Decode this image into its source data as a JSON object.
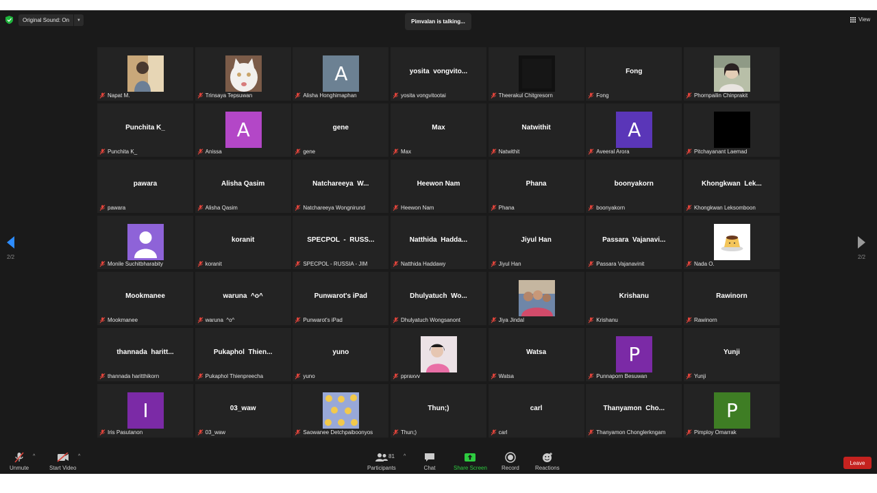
{
  "topbar": {
    "original_sound": "Original Sound: On",
    "talking": "Pimvalan is talking...",
    "view": "View"
  },
  "pager": {
    "left_page": "2/2",
    "right_page": "2/2"
  },
  "tiles": [
    {
      "name": "Napat M.",
      "type": "photo",
      "photo": "photo-person-1",
      "bg": "#c9a87a"
    },
    {
      "name": "Trinsaya Tepsuwan",
      "type": "photo",
      "photo": "photo-cat",
      "bg": "#8a6f5a"
    },
    {
      "name": "Alisha Honghimaphan",
      "type": "letter",
      "letter": "A",
      "bg": "#6c8193"
    },
    {
      "name": "yosita vongvitootai",
      "type": "text",
      "display": "yosita  vongvito..."
    },
    {
      "name": "Theerakul Chitgresorn",
      "type": "photo",
      "photo": "photo-dark",
      "bg": "#141414"
    },
    {
      "name": "Fong",
      "type": "text",
      "display": "Fong"
    },
    {
      "name": "Phornpailin Chinprakit",
      "type": "photo",
      "photo": "photo-person-2",
      "bg": "#a7b29a"
    },
    {
      "name": "Punchita K_",
      "type": "text",
      "display": "Punchita K_"
    },
    {
      "name": "Anissa",
      "type": "letter",
      "letter": "A",
      "bg": "#b347c7"
    },
    {
      "name": "gene",
      "type": "text",
      "display": "gene"
    },
    {
      "name": "Max",
      "type": "text",
      "display": "Max"
    },
    {
      "name": "Natwithit",
      "type": "text",
      "display": "Natwithit"
    },
    {
      "name": "Aveeral Arora",
      "type": "letter",
      "letter": "A",
      "bg": "#5a36b8"
    },
    {
      "name": "Pitchayanant Laemad",
      "type": "photo",
      "photo": "photo-black",
      "bg": "#000000"
    },
    {
      "name": "pawara",
      "type": "text",
      "display": "pawara"
    },
    {
      "name": "Alisha Qasim",
      "type": "text",
      "display": "Alisha Qasim"
    },
    {
      "name": "Natchareeya Wongnirund",
      "type": "text",
      "display": "Natchareeya  W..."
    },
    {
      "name": "Heewon Nam",
      "type": "text",
      "display": "Heewon Nam"
    },
    {
      "name": "Phana",
      "type": "text",
      "display": "Phana"
    },
    {
      "name": "boonyakorn",
      "type": "text",
      "display": "boonyakorn"
    },
    {
      "name": "Khongkwan Leksomboon",
      "type": "text",
      "display": "Khongkwan  Lek..."
    },
    {
      "name": "Monile Suchitbharabity",
      "type": "photo",
      "photo": "photo-default-user",
      "bg": "#8e63d8"
    },
    {
      "name": "koranit",
      "type": "text",
      "display": "koranit"
    },
    {
      "name": "SPECPOL - RUSSIA - JIM",
      "type": "text",
      "display": "SPECPOL  -  RUSS..."
    },
    {
      "name": "Natthida Haddawy",
      "type": "text",
      "display": "Natthida  Hadda..."
    },
    {
      "name": "Jiyul Han",
      "type": "text",
      "display": "Jiyul Han"
    },
    {
      "name": "Passara Vajanavinit",
      "type": "text",
      "display": "Passara  Vajanavi..."
    },
    {
      "name": "Nada O.",
      "type": "photo",
      "photo": "photo-pudding",
      "bg": "#ffffff"
    },
    {
      "name": "Mookmanee",
      "type": "text",
      "display": "Mookmanee"
    },
    {
      "name": "waruna  ^o^",
      "type": "text",
      "display": "waruna  ^o^"
    },
    {
      "name": "Punwarot's iPad",
      "type": "text",
      "display": "Punwarot's iPad"
    },
    {
      "name": "Dhulyatuch Wongsanont",
      "type": "text",
      "display": "Dhulyatuch  Wo..."
    },
    {
      "name": "Jiya Jindal",
      "type": "photo",
      "photo": "photo-group",
      "bg": "#7a8fb0"
    },
    {
      "name": "Krishanu",
      "type": "text",
      "display": "Krishanu"
    },
    {
      "name": "Rawinorn",
      "type": "text",
      "display": "Rawinorn"
    },
    {
      "name": "thannada haritthikorn",
      "type": "text",
      "display": "thannada  haritt..."
    },
    {
      "name": "Pukaphol Thienpreecha",
      "type": "text",
      "display": "Pukaphol  Thien..."
    },
    {
      "name": "yuno",
      "type": "text",
      "display": "yuno"
    },
    {
      "name": "ppraxvv",
      "type": "photo",
      "photo": "photo-girl-pink",
      "bg": "#e6c3d0"
    },
    {
      "name": "Watsa",
      "type": "text",
      "display": "Watsa"
    },
    {
      "name": "Punnaporn Besuwan",
      "type": "letter",
      "letter": "P",
      "bg": "#7b2aa6"
    },
    {
      "name": "Yunji",
      "type": "text",
      "display": "Yunji"
    },
    {
      "name": "Iris Pasutanon",
      "type": "letter",
      "letter": "I",
      "bg": "#7b2aa6"
    },
    {
      "name": "03_waw",
      "type": "text",
      "display": "03_waw"
    },
    {
      "name": "Saowanee Detchpaiboonyos",
      "type": "photo",
      "photo": "photo-smileys",
      "bg": "#8ea0d6"
    },
    {
      "name": "Thun;)",
      "type": "text",
      "display": "Thun;)"
    },
    {
      "name": "carl",
      "type": "text",
      "display": "carl"
    },
    {
      "name": "Thanyamon Chonglerkngam",
      "type": "text",
      "display": "Thanyamon  Cho..."
    },
    {
      "name": "Pimploy Omarrak",
      "type": "letter",
      "letter": "P",
      "bg": "#3e7d24"
    }
  ],
  "toolbar": {
    "unmute": "Unmute",
    "start_video": "Start Video",
    "participants": "Participants",
    "participants_count": "81",
    "chat": "Chat",
    "share_screen": "Share Screen",
    "record": "Record",
    "reactions": "Reactions",
    "leave": "Leave"
  },
  "colors": {
    "background": "#1a1a1a",
    "tile": "#232323",
    "share_green": "#2ecc40",
    "leave_red": "#c5221f",
    "muted_red": "#e0443b",
    "nav_blue": "#2d8cff"
  }
}
